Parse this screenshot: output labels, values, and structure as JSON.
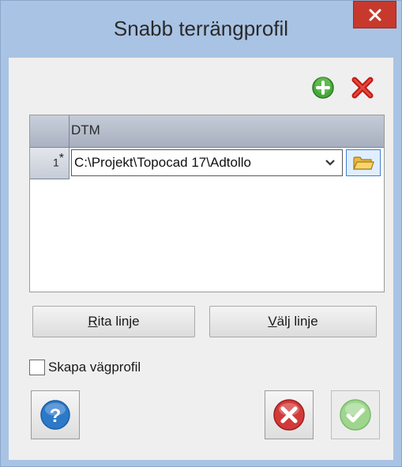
{
  "window": {
    "title": "Snabb terrängprofil"
  },
  "toolbar": {
    "add_icon": "add-icon",
    "delete_icon": "delete-icon"
  },
  "grid": {
    "columns": [
      "DTM"
    ],
    "rows": [
      {
        "number": "1",
        "marker": "*",
        "value": "C:\\Projekt\\Topocad 17\\Adtollo"
      }
    ]
  },
  "buttons": {
    "rita_prefix": "R",
    "rita_rest": "ita linje",
    "valj_prefix": "V",
    "valj_rest": "älj linje"
  },
  "checkbox": {
    "label": "Skapa vägprofil",
    "checked": false
  },
  "colors": {
    "frame": "#a9c3e4",
    "close": "#c7392c",
    "help_blue": "#2c79c9",
    "cancel_red": "#d23a3a",
    "ok_green": "#8fcf7f"
  }
}
